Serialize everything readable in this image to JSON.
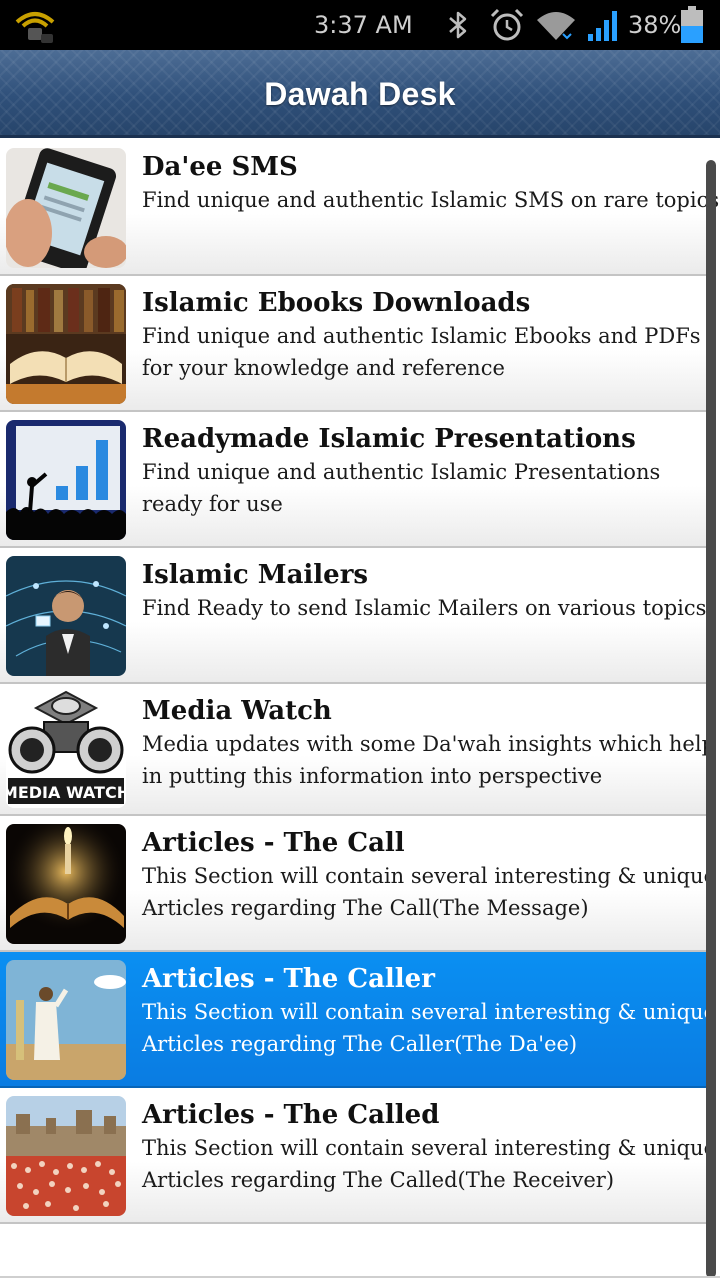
{
  "status_bar": {
    "time": "3:37 AM",
    "battery": "38%",
    "icons": [
      "audiobook-app-icon",
      "bluetooth-icon",
      "alarm-icon",
      "wifi-icon",
      "signal-icon",
      "battery-icon"
    ]
  },
  "app": {
    "title": "Dawah Desk"
  },
  "list": {
    "items": [
      {
        "title": "Da'ee SMS",
        "desc1": "Find unique and authentic Islamic SMS on rare topics",
        "desc2": "",
        "image": "phone-sms"
      },
      {
        "title": "Islamic Ebooks Downloads",
        "desc1": "Find unique and authentic Islamic Ebooks and PDFs",
        "desc2": "for your knowledge and reference",
        "image": "open-book"
      },
      {
        "title": "Readymade Islamic Presentations",
        "desc1": "Find unique and authentic Islamic Presentations",
        "desc2": "ready for use",
        "image": "presentation"
      },
      {
        "title": "Islamic Mailers",
        "desc1": "Find Ready to send Islamic Mailers on various topics",
        "desc2": "",
        "image": "mailers"
      },
      {
        "title": "Media Watch",
        "desc1": "Media updates with some Da'wah insights which help",
        "desc2": "in putting this information into perspective",
        "image": "media-watch",
        "logo_text": "MEDIA WATCH"
      },
      {
        "title": "Articles - The Call",
        "desc1": "This Section will contain several interesting & unique",
        "desc2": "Articles regarding The Call(The Message)",
        "image": "candle-book"
      },
      {
        "title": "Articles - The Caller",
        "desc1": "This Section will contain several interesting & unique",
        "desc2": "Articles regarding The Caller(The Da'ee)",
        "image": "caller",
        "selected": true
      },
      {
        "title": "Articles - The Called",
        "desc1": "This Section will contain several interesting & unique",
        "desc2": "Articles regarding The Called(The Receiver)",
        "image": "crowd"
      }
    ]
  },
  "colors": {
    "selected_row": "#0a86ec",
    "title_bar": "#2f507a",
    "status_bar": "#000000"
  }
}
